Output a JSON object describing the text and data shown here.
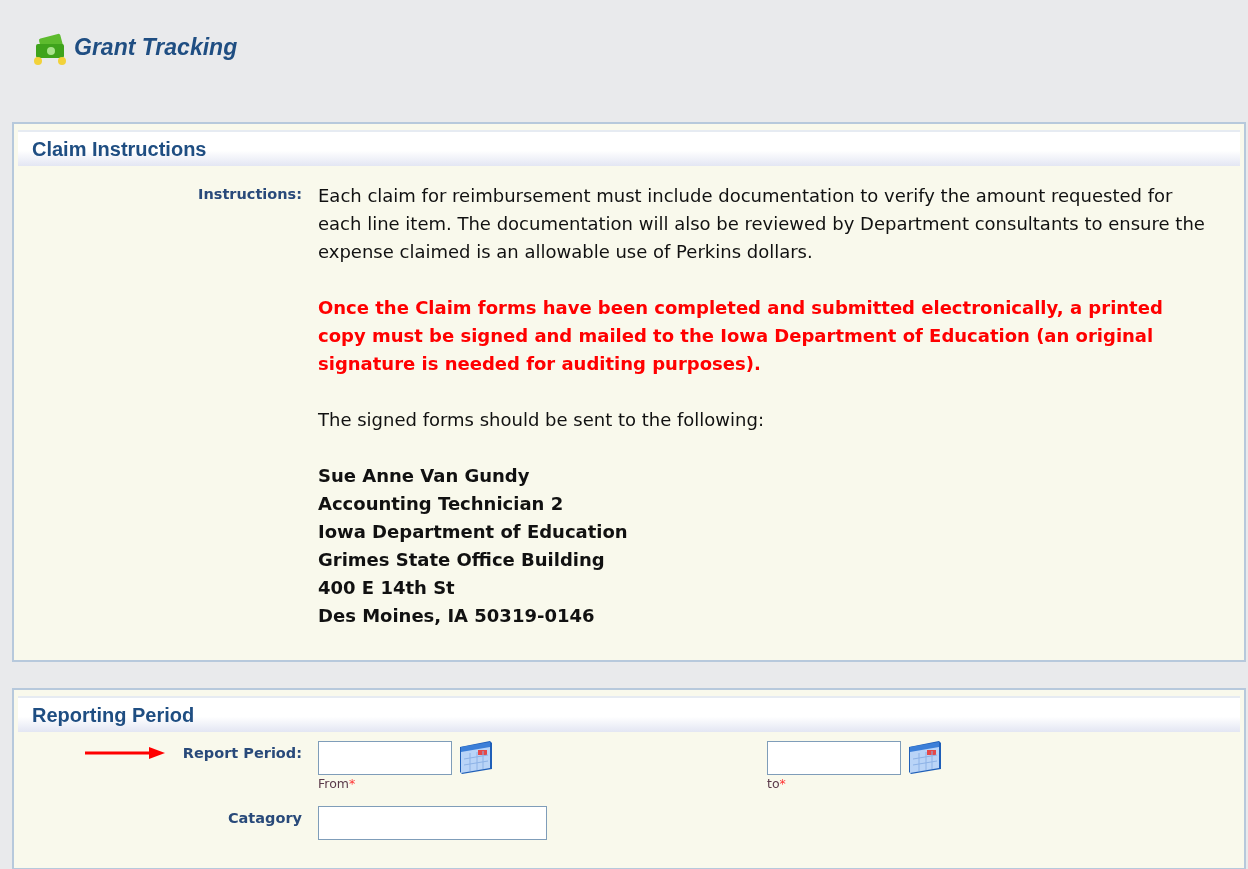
{
  "app": {
    "title": "Grant Tracking"
  },
  "claim_instructions": {
    "title": "Claim Instructions",
    "label": "Instructions:",
    "paragraphs": [
      {
        "kind": "plain",
        "text": "Each claim for reimbursement must include documentation to verify the amount requested for each line item. The documentation will also be reviewed by Department consultants to ensure the expense claimed is an allowable use of Perkins dollars."
      },
      {
        "kind": "warning",
        "text": "Once the Claim forms have been completed and submitted electronically, a printed copy must be signed and mailed to the Iowa Department of Education (an original signature is needed for auditing purposes)."
      },
      {
        "kind": "plain",
        "text": "The signed forms should be sent to the following:"
      },
      {
        "kind": "address",
        "lines": [
          "Sue Anne Van Gundy",
          "Accounting Technician 2",
          "Iowa Department of Education",
          "Grimes State Office Building",
          "400 E 14th St",
          "Des Moines, IA 50319-0146"
        ]
      }
    ]
  },
  "reporting_period": {
    "title": "Reporting Period",
    "fields": [
      {
        "label": "Report Period:",
        "pointer_arrow": true,
        "inputs": [
          {
            "caption": "From",
            "required_mark": "*",
            "calendar": true
          },
          {
            "caption": "to",
            "required_mark": "*",
            "calendar": true
          }
        ]
      },
      {
        "label": "Catagory",
        "pointer_arrow": false,
        "inputs": [
          {
            "calendar": false
          }
        ]
      }
    ]
  }
}
